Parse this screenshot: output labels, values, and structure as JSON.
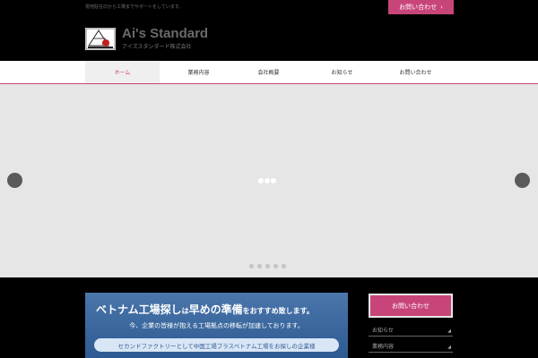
{
  "header": {
    "tagline": "現地駐在のから工場までサポートをしています。",
    "contact_button": "お問い合わせ",
    "logo_name": "Ai's Standard",
    "logo_sub": "アイズスタンダード株式会社"
  },
  "nav": {
    "items": [
      {
        "label": "ホーム"
      },
      {
        "label": "業務内容"
      },
      {
        "label": "会社概要"
      },
      {
        "label": "お知らせ"
      },
      {
        "label": "お問い合わせ"
      }
    ],
    "active_index": 0
  },
  "slider": {
    "slide_count": 5
  },
  "banner": {
    "headline_1": "ベトナム工場探し",
    "headline_2": "は",
    "headline_3": "早めの準備",
    "headline_4": "をおすすめ致します。",
    "text": "今、企業の皆様が抱える工場拠点の移転が加速しております。",
    "pill": "セカンドファクトリーとして中国工場プラスベトナム工場をお探しの企業様"
  },
  "sidebar": {
    "contact_button": "お問い合わせ",
    "links": [
      {
        "label": "お知らせ"
      },
      {
        "label": "業務内容"
      }
    ]
  },
  "colors": {
    "accent": "#c8457a",
    "banner": "#2d5a92"
  }
}
